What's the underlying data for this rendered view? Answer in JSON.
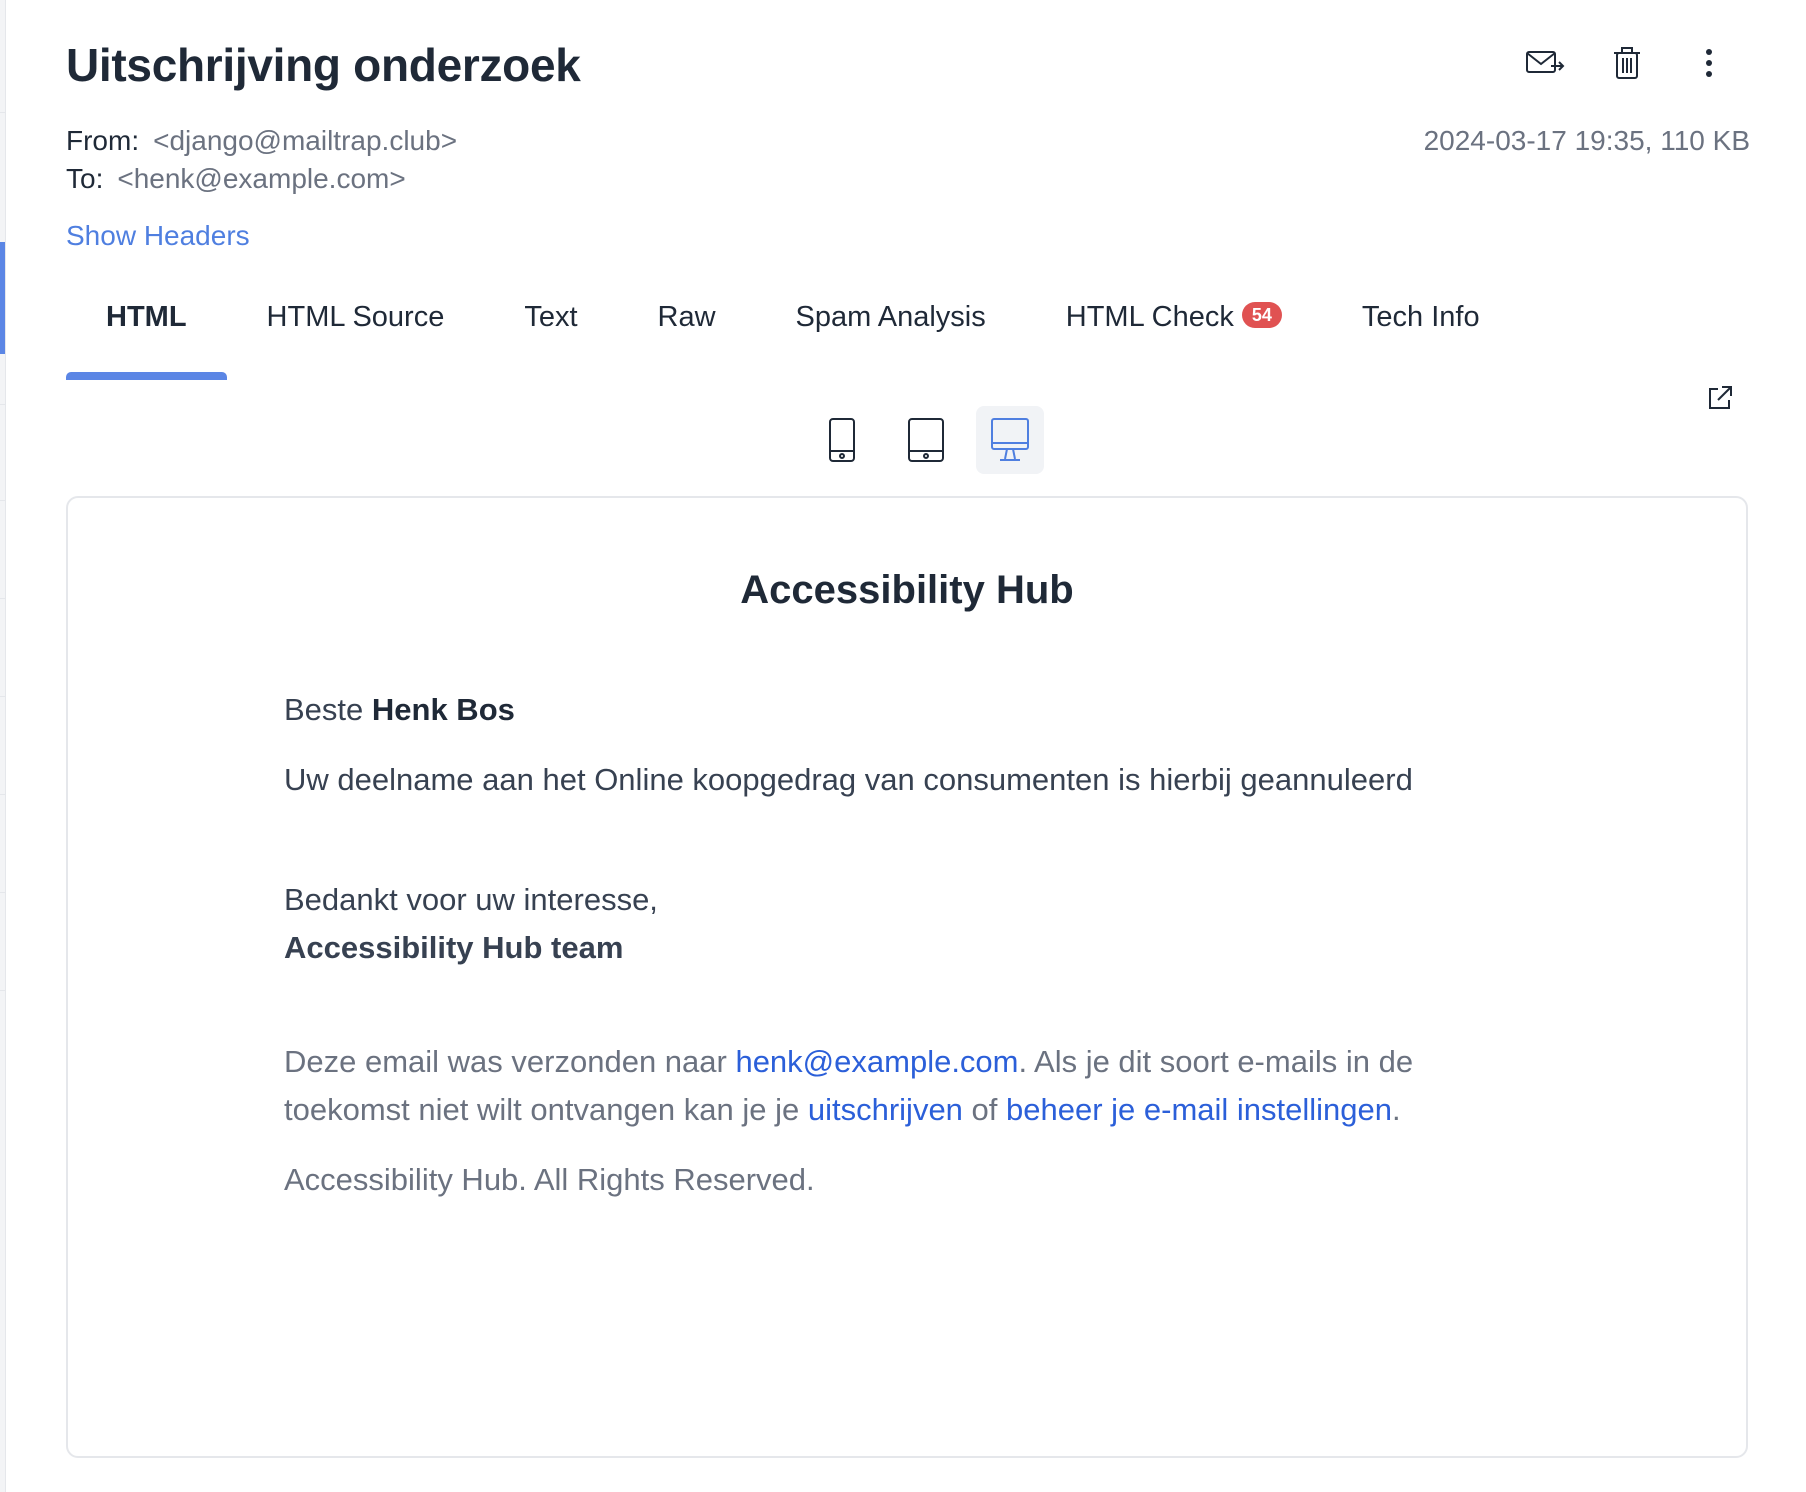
{
  "email": {
    "subject": "Uitschrijving onderzoek",
    "from_label": "From:",
    "from_value": "<django@mailtrap.club>",
    "to_label": "To:",
    "to_value": "<henk@example.com>",
    "date_size": "2024-03-17 19:35, 110 KB",
    "show_headers": "Show Headers"
  },
  "actions": {
    "forward_icon": "envelope-forward-icon",
    "delete_icon": "trash-icon",
    "more_icon": "kebab-menu-icon"
  },
  "tabs": [
    {
      "label": "HTML",
      "active": true
    },
    {
      "label": "HTML Source",
      "active": false
    },
    {
      "label": "Text",
      "active": false
    },
    {
      "label": "Raw",
      "active": false
    },
    {
      "label": "Spam Analysis",
      "active": false
    },
    {
      "label": "HTML Check",
      "active": false,
      "badge": "54"
    },
    {
      "label": "Tech Info",
      "active": false
    }
  ],
  "view_modes": [
    "mobile-icon",
    "tablet-icon",
    "desktop-icon"
  ],
  "active_view_mode": "desktop",
  "preview": {
    "brand": "Accessibility Hub",
    "greeting_prefix": "Beste ",
    "greeting_name": "Henk Bos",
    "cancel_message": "Uw deelname aan het Online koopgedrag van consumenten is hierbij geannuleerd",
    "thanks_line": "Bedankt voor uw interesse,",
    "team_line": "Accessibility Hub team",
    "footer_part1": "Deze email was verzonden naar ",
    "footer_email": "henk@example.com",
    "footer_part2": ". Als je dit soort e-mails in de toekomst niet wilt ontvangen kan je je ",
    "footer_unsubscribe": "uitschrijven",
    "footer_part3": " of ",
    "footer_manage": "beheer je e-mail instellingen",
    "footer_part4": ".",
    "copyright": "Accessibility Hub. All Rights Reserved."
  },
  "colors": {
    "accent": "#5b86e5",
    "link": "#2b5fd9",
    "badge": "#e05252",
    "text": "#1f2937",
    "muted": "#6b7280"
  }
}
